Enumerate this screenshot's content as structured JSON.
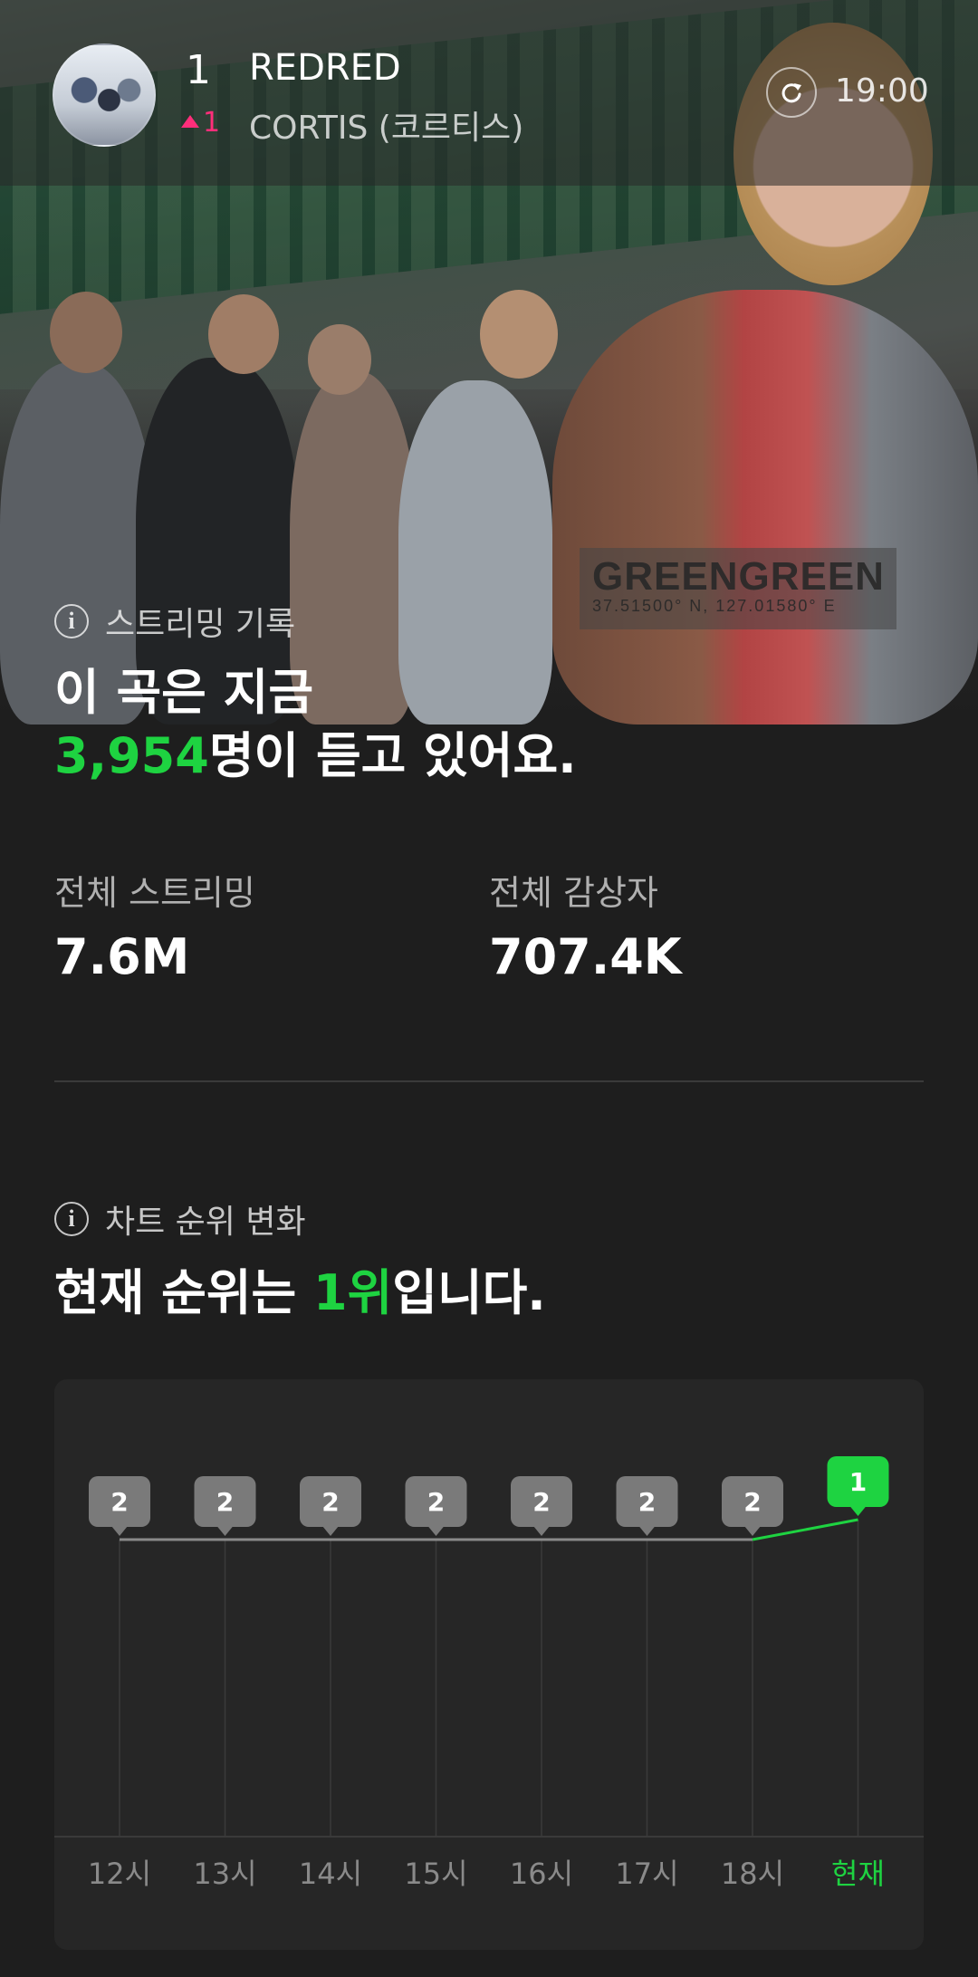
{
  "header": {
    "rank": "1",
    "rank_change": "1",
    "title": "REDRED",
    "artist": "CORTIS (코르티스)",
    "time": "19:00",
    "icons": {
      "refresh": "refresh-icon",
      "rank_up": "triangle-up-icon"
    }
  },
  "hero": {
    "sign_text": "GREENGREEN",
    "sign_sub": "37.51500° N, 127.01580° E"
  },
  "streaming": {
    "section_label": "스트리밍 기록",
    "headline_line1": "이 곡은 지금",
    "listeners_now": "3,954",
    "headline_line2_suffix": "명이 듣고 있어요.",
    "total_streams_label": "전체 스트리밍",
    "total_streams_value": "7.6M",
    "total_listeners_label": "전체 감상자",
    "total_listeners_value": "707.4K"
  },
  "rank_section": {
    "section_label": "차트 순위 변화",
    "headline_prefix": "현재 순위는 ",
    "current_rank": "1위",
    "headline_suffix": "입니다."
  },
  "chart_data": {
    "type": "line",
    "categories": [
      "12시",
      "13시",
      "14시",
      "15시",
      "16시",
      "17시",
      "18시",
      "현재"
    ],
    "values": [
      2,
      2,
      2,
      2,
      2,
      2,
      2,
      1
    ],
    "highlight_index": 7,
    "colors": {
      "normal": "#7a7a7a",
      "highlight": "#1ed341",
      "line": "#8a8a8a",
      "grid": "#3a3a3a",
      "label": "#8a8a8a"
    }
  }
}
